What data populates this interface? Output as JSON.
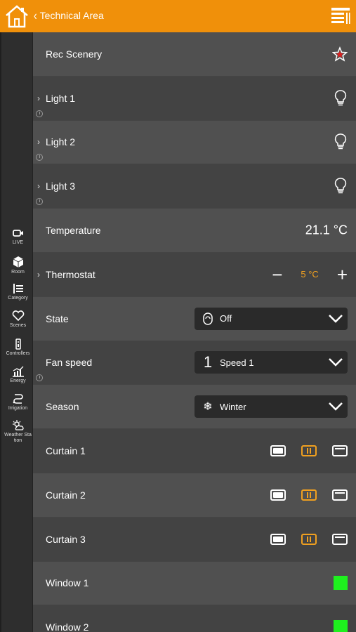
{
  "header": {
    "back_label": "Technical Area"
  },
  "rail": [
    {
      "label": "LIVE",
      "icon": "camera-icon"
    },
    {
      "label": "Room",
      "icon": "cube-icon"
    },
    {
      "label": "Category",
      "icon": "category-icon"
    },
    {
      "label": "Scenes",
      "icon": "heart-icon"
    },
    {
      "label": "Controllers",
      "icon": "remote-icon"
    },
    {
      "label": "Energy",
      "icon": "energy-chart-icon"
    },
    {
      "label": "Irrigation",
      "icon": "irrigation-icon"
    },
    {
      "label": "Weather Sta tion",
      "icon": "weather-icon"
    }
  ],
  "rows": {
    "rec_scenery": "Rec Scenery",
    "light1": "Light 1",
    "light2": "Light 2",
    "light3": "Light 3",
    "temperature": "Temperature",
    "temperature_value": "21.1 °C",
    "thermostat": "Thermostat",
    "thermostat_value": "5 °C",
    "thermostat_minus": "−",
    "thermostat_plus": "+",
    "state": "State",
    "state_value": "Off",
    "fan_speed": "Fan speed",
    "fan_speed_icon": "1",
    "fan_speed_value": "Speed 1",
    "season": "Season",
    "season_icon": "❄",
    "season_value": "Winter",
    "curtain1": "Curtain 1",
    "curtain2": "Curtain 2",
    "curtain3": "Curtain 3",
    "window1": "Window 1",
    "window2": "Window 2"
  },
  "colors": {
    "accent": "#f0900a",
    "on": "#1ef01e",
    "thermo_value": "#f0a020"
  }
}
